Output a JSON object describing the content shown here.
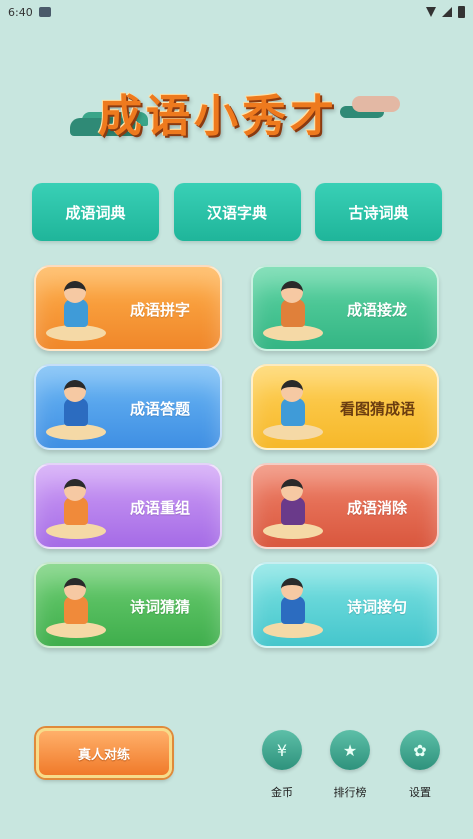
{
  "status_bar": {
    "time": "6:40",
    "icons": [
      "wifi-icon",
      "signal-icon",
      "battery-icon"
    ]
  },
  "title": "成语小秀才",
  "dictionaries": [
    {
      "label": "成语词典"
    },
    {
      "label": "汉语字典"
    },
    {
      "label": "古诗词典"
    }
  ],
  "games": [
    {
      "label": "成语拼字",
      "color": "#f59a36"
    },
    {
      "label": "成语接龙",
      "color": "#45c392"
    },
    {
      "label": "成语答题",
      "color": "#529fec"
    },
    {
      "label": "看图猜成语",
      "color": "#f9c53e"
    },
    {
      "label": "成语重组",
      "color": "#b985ee"
    },
    {
      "label": "成语消除",
      "color": "#e36d53"
    },
    {
      "label": "诗词猜猜",
      "color": "#55be5e"
    },
    {
      "label": "诗词接句",
      "color": "#62d5d8"
    }
  ],
  "bottom": {
    "pk_label": "真人对练",
    "nav": [
      {
        "label": "金币",
        "icon": "coin-bag-icon"
      },
      {
        "label": "排行榜",
        "icon": "medal-icon"
      },
      {
        "label": "设置",
        "icon": "gear-icon"
      }
    ]
  }
}
